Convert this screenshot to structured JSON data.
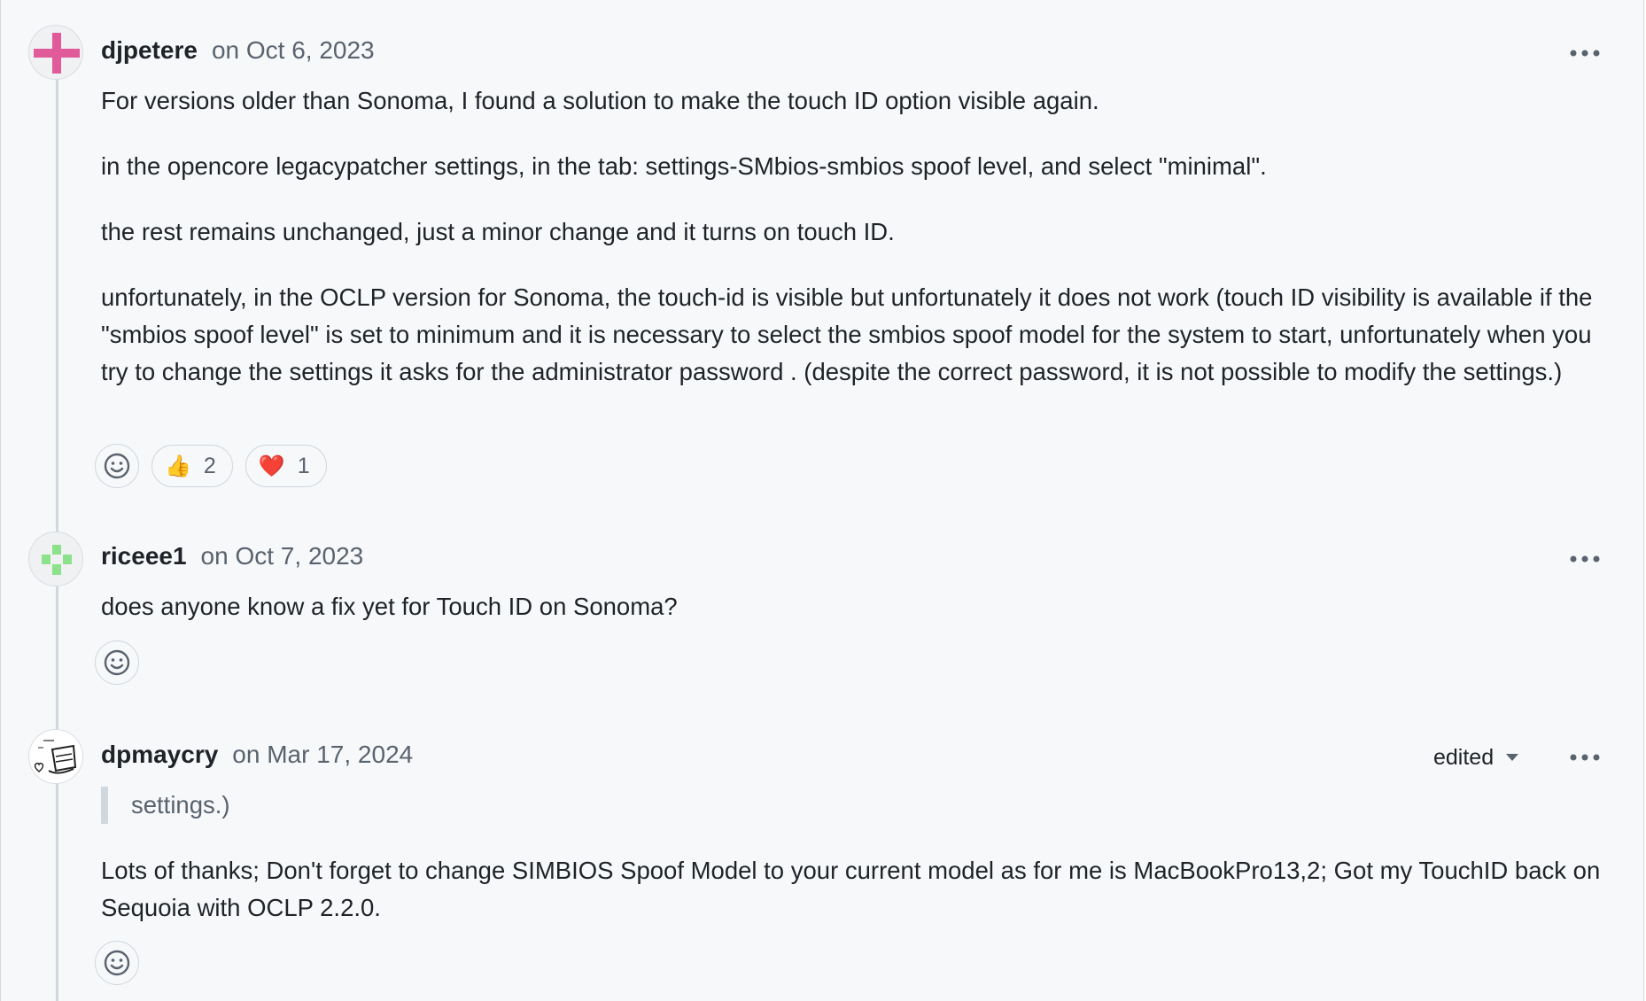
{
  "comments": [
    {
      "author": "djpetere",
      "date": "on Oct 6, 2023",
      "edited_label": "",
      "paragraphs": [
        "For versions older than Sonoma, I found a solution to make the touch ID option visible again.",
        "in the opencore legacypatcher settings, in the tab: settings-SMbios-smbios spoof level, and select \"minimal\".",
        "the rest remains unchanged, just a minor change and it turns on touch ID.",
        "unfortunately, in the OCLP version for Sonoma, the touch-id is visible but unfortunately it does not work (touch ID visibility is available if the \"smbios spoof level\" is set to minimum and it is necessary to select the smbios spoof model for the system to start, unfortunately when you try to change the settings it asks for the administrator password . (despite the correct password, it is not possible to modify the settings.)"
      ],
      "reactions": [
        {
          "emoji": "👍",
          "icon": "thumbs-up-icon",
          "count": "2"
        },
        {
          "emoji": "❤️",
          "icon": "heart-icon",
          "count": "1"
        }
      ]
    },
    {
      "author": "riceee1",
      "date": "on Oct 7, 2023",
      "paragraphs": [
        "does anyone know a fix yet for Touch ID on Sonoma?"
      ],
      "reactions": []
    },
    {
      "author": "dpmaycry",
      "date": "on Mar 17, 2024",
      "edited_label": "edited",
      "quote": "settings.)",
      "paragraphs": [
        "Lots of thanks; Don't forget to change SIMBIOS Spoof Model to your current model as for me is MacBookPro13,2; Got my TouchID back on Sequoia with OCLP 2.2.0."
      ],
      "reactions": []
    }
  ],
  "icons": {
    "menu": "kebab-horizontal-icon",
    "add_reaction": "smiley-icon",
    "edited_dropdown": "triangle-down-icon"
  },
  "colors": {
    "background": "#f6f8fa",
    "text": "#1f2328",
    "muted": "#59636e",
    "border": "#d0d7de",
    "avatar1": "#e15a9a",
    "avatar2": "#8be28b"
  }
}
